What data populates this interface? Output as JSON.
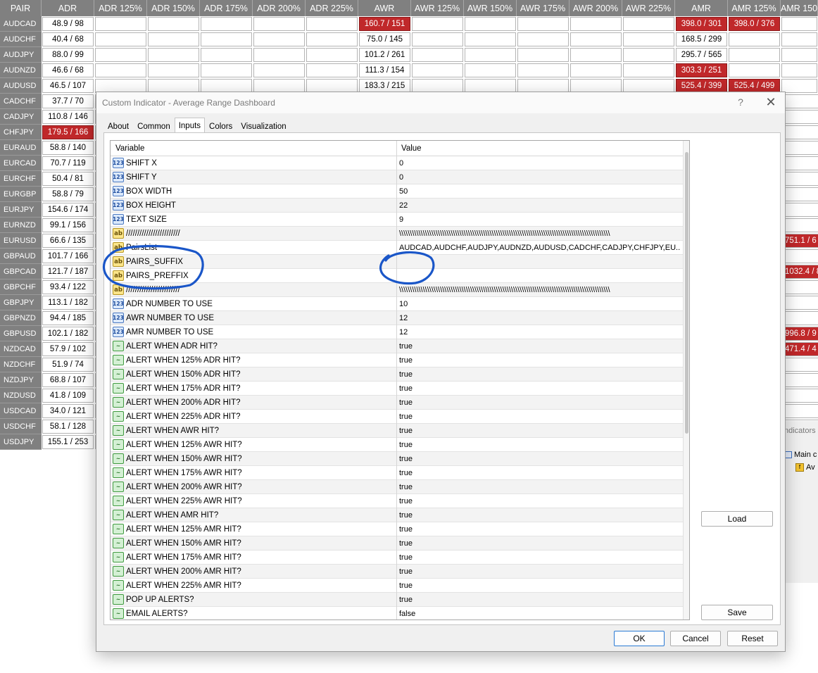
{
  "dashboard": {
    "headers": [
      "PAIR",
      "ADR",
      "ADR 125%",
      "ADR 150%",
      "ADR 175%",
      "ADR 200%",
      "ADR 225%",
      "AWR",
      "AWR 125%",
      "AWR 150%",
      "AWR 175%",
      "AWR 200%",
      "AWR 225%",
      "AMR",
      "AMR 125%",
      "AMR 150"
    ],
    "pairs": [
      "AUDCAD",
      "AUDCHF",
      "AUDJPY",
      "AUDNZD",
      "AUDUSD",
      "CADCHF",
      "CADJPY",
      "CHFJPY",
      "EURAUD",
      "EURCAD",
      "EURCHF",
      "EURGBP",
      "EURJPY",
      "EURNZD",
      "EURUSD",
      "GBPAUD",
      "GBPCAD",
      "GBPCHF",
      "GBPJPY",
      "GBPNZD",
      "GBPUSD",
      "NZDCAD",
      "NZDCHF",
      "NZDJPY",
      "NZDUSD",
      "USDCAD",
      "USDCHF",
      "USDJPY"
    ],
    "adr": [
      "48.9 / 98",
      "40.4 / 68",
      "88.0 / 99",
      "46.6 / 68",
      "46.5 / 107",
      "37.7 / 70",
      "110.8 / 146",
      "179.5 / 166",
      "58.8 / 140",
      "70.7 / 119",
      "50.4 / 81",
      "58.8 / 79",
      "154.6 / 174",
      "99.1 / 156",
      "66.6 / 135",
      "101.7 / 166",
      "121.7 / 187",
      "93.4 / 122",
      "113.1 / 182",
      "94.4 / 185",
      "102.1 / 182",
      "57.9 / 102",
      "51.9 / 74",
      "68.8 / 107",
      "41.8 / 109",
      "34.0 / 121",
      "58.1 / 128",
      "155.1 / 253"
    ],
    "adr_hot_index": 7,
    "awr": [
      "160.7 / 151",
      "75.0 / 145",
      "101.2 / 261",
      "111.3 / 154",
      "183.3 / 215"
    ],
    "awr_hot_index": 0,
    "amr": [
      "398.0 / 301",
      "168.5 / 299",
      "295.7 / 565",
      "303.3 / 251",
      "525.4 / 399"
    ],
    "amr_hot": [
      true,
      false,
      false,
      true,
      true
    ],
    "amr125": [
      "398.0 / 376",
      "",
      "",
      "",
      "525.4 / 499"
    ],
    "amr125_hot": [
      true,
      false,
      false,
      false,
      true
    ],
    "right_edge": [
      {
        "row": 14,
        "text": "751.1 / 6"
      },
      {
        "row": 16,
        "text": "1032.4 / 8"
      },
      {
        "row": 20,
        "text": "996.8 / 9"
      },
      {
        "row": 21,
        "text": "471.4 / 4"
      }
    ]
  },
  "navigator": {
    "header": "ndicators c",
    "item_main": "Main c",
    "item_sub": "Av"
  },
  "dialog": {
    "title": "Custom Indicator - Average Range Dashboard",
    "help": "?",
    "close": "✕",
    "tabs": [
      "About",
      "Common",
      "Inputs",
      "Colors",
      "Visualization"
    ],
    "active_tab": "Inputs",
    "grid": {
      "col_variable": "Variable",
      "col_value": "Value",
      "rows": [
        {
          "type": "num",
          "name": "SHIFT X",
          "value": "0"
        },
        {
          "type": "num",
          "name": "SHIFT Y",
          "value": "0"
        },
        {
          "type": "num",
          "name": "BOX WIDTH",
          "value": "50"
        },
        {
          "type": "num",
          "name": "BOX HEIGHT",
          "value": "22"
        },
        {
          "type": "num",
          "name": "TEXT SIZE",
          "value": "9"
        },
        {
          "type": "str",
          "name": "////////////////////////",
          "value": "\\\\\\\\\\\\\\\\\\\\\\\\\\\\\\\\\\\\\\\\\\\\\\\\\\\\\\\\\\\\\\\\\\\\\\\\\\\\\\\\\\\\\\\\\\\\\\\\\\\\\\\\\\\\\\\\\\\\\\\\\\\\\\\\\\\\\\\\\\\\\\\\\\\\\\\\\\\\\\\\\\\\\\\\\\\\\\\\\\\\\\\\\\\\\\\\\\\\"
        },
        {
          "type": "str",
          "name": "PairsList",
          "value": "AUDCAD,AUDCHF,AUDJPY,AUDNZD,AUDUSD,CADCHF,CADJPY,CHFJPY,EU..."
        },
        {
          "type": "str",
          "name": "PAIRS_SUFFIX",
          "value": ""
        },
        {
          "type": "str",
          "name": "PAIRS_PREFFIX",
          "value": ""
        },
        {
          "type": "str",
          "name": "////////////////////////",
          "value": "\\\\\\\\\\\\\\\\\\\\\\\\\\\\\\\\\\\\\\\\\\\\\\\\\\\\\\\\\\\\\\\\\\\\\\\\\\\\\\\\\\\\\\\\\\\\\\\\\\\\\\\\\\\\\\\\\\\\\\\\\\\\\\\\\\\\\\\\\\\\\\\\\\\\\\\\\\\\\\\\\\\\\\\\\\\\\\\\\\\\\\\\\\\\\\\\\\\\"
        },
        {
          "type": "num",
          "name": "ADR NUMBER TO USE",
          "value": "10"
        },
        {
          "type": "num",
          "name": "AWR NUMBER TO USE",
          "value": "12"
        },
        {
          "type": "num",
          "name": "AMR NUMBER TO USE",
          "value": "12"
        },
        {
          "type": "bool",
          "name": "ALERT WHEN ADR HIT?",
          "value": "true"
        },
        {
          "type": "bool",
          "name": "ALERT WHEN 125% ADR HIT?",
          "value": "true"
        },
        {
          "type": "bool",
          "name": "ALERT WHEN 150% ADR HIT?",
          "value": "true"
        },
        {
          "type": "bool",
          "name": "ALERT WHEN 175% ADR HIT?",
          "value": "true"
        },
        {
          "type": "bool",
          "name": "ALERT WHEN 200% ADR HIT?",
          "value": "true"
        },
        {
          "type": "bool",
          "name": "ALERT WHEN 225% ADR HIT?",
          "value": "true"
        },
        {
          "type": "bool",
          "name": "ALERT WHEN AWR HIT?",
          "value": "true"
        },
        {
          "type": "bool",
          "name": "ALERT WHEN 125% AWR HIT?",
          "value": "true"
        },
        {
          "type": "bool",
          "name": "ALERT WHEN 150% AWR HIT?",
          "value": "true"
        },
        {
          "type": "bool",
          "name": "ALERT WHEN 175% AWR HIT?",
          "value": "true"
        },
        {
          "type": "bool",
          "name": "ALERT WHEN 200% AWR HIT?",
          "value": "true"
        },
        {
          "type": "bool",
          "name": "ALERT WHEN 225% AWR HIT?",
          "value": "true"
        },
        {
          "type": "bool",
          "name": "ALERT WHEN AMR HIT?",
          "value": "true"
        },
        {
          "type": "bool",
          "name": "ALERT WHEN 125% AMR HIT?",
          "value": "true"
        },
        {
          "type": "bool",
          "name": "ALERT WHEN 150% AMR HIT?",
          "value": "true"
        },
        {
          "type": "bool",
          "name": "ALERT WHEN 175% AMR HIT?",
          "value": "true"
        },
        {
          "type": "bool",
          "name": "ALERT WHEN 200% AMR HIT?",
          "value": "true"
        },
        {
          "type": "bool",
          "name": "ALERT WHEN 225% AMR HIT?",
          "value": "true"
        },
        {
          "type": "bool",
          "name": "POP UP ALERTS?",
          "value": "true"
        },
        {
          "type": "bool",
          "name": "EMAIL ALERTS?",
          "value": "false"
        }
      ]
    },
    "buttons": {
      "load": "Load",
      "save": "Save",
      "ok": "OK",
      "cancel": "Cancel",
      "reset": "Reset"
    },
    "icon_labels": {
      "num": "123",
      "str": "ab",
      "bool": "~"
    }
  },
  "colors": {
    "hot": "#c0282a",
    "annotation": "#1a56c8",
    "header_gray": "#808080"
  }
}
